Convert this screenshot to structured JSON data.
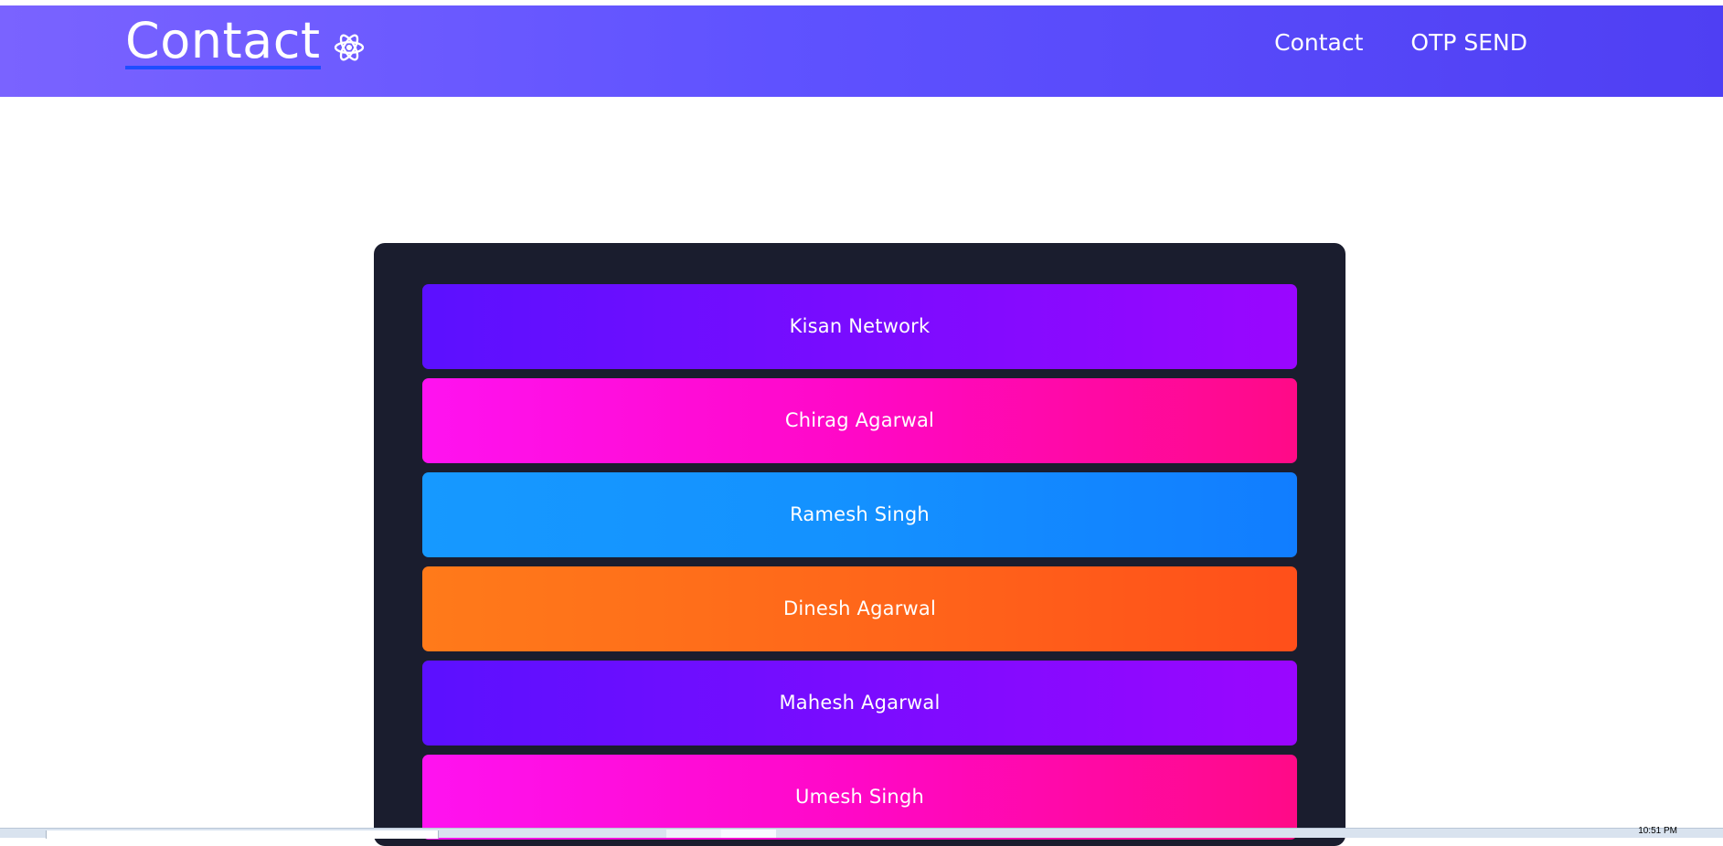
{
  "header": {
    "brand": "Contact",
    "brand_icon": "react-atom-icon",
    "nav": [
      {
        "label": "Contact"
      },
      {
        "label": "OTP SEND"
      }
    ]
  },
  "contacts": [
    {
      "name": "Kisan Network",
      "style": "purple"
    },
    {
      "name": "Chirag Agarwal",
      "style": "pink"
    },
    {
      "name": "Ramesh Singh",
      "style": "blue"
    },
    {
      "name": "Dinesh Agarwal",
      "style": "orange"
    },
    {
      "name": "Mahesh Agarwal",
      "style": "purple"
    },
    {
      "name": "Umesh Singh",
      "style": "pink"
    }
  ],
  "taskbar": {
    "clock_partial": "10:51 PM"
  },
  "colors": {
    "navbar_start": "#7a63ff",
    "navbar_end": "#4f3ff3",
    "panel_bg": "#1a1d2e",
    "brand_underline": "#1f4dff"
  }
}
